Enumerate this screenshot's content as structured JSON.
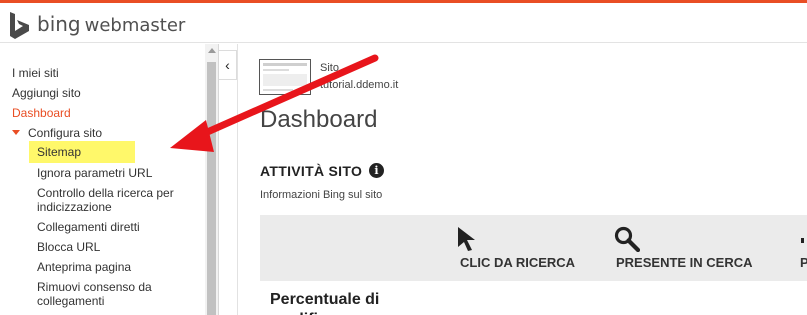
{
  "app": {
    "brand_bing": "bing",
    "brand_webmaster": "webmaster",
    "accent_color": "#e94e24"
  },
  "sidebar": {
    "items": [
      {
        "label": "I miei siti"
      },
      {
        "label": "Aggiungi sito"
      },
      {
        "label": "Dashboard",
        "active": true
      },
      {
        "label": "Configura sito",
        "expanded": true
      }
    ],
    "subitems": [
      {
        "label": "Sitemap",
        "highlighted": true
      },
      {
        "label": "Ignora parametri URL"
      },
      {
        "label": "Controllo della ricerca per indicizzazione"
      },
      {
        "label": "Collegamenti diretti"
      },
      {
        "label": "Blocca URL"
      },
      {
        "label": "Anteprima pagina"
      },
      {
        "label": "Rimuovi consenso da collegamenti"
      }
    ],
    "collapse_icon": "chevron-left-icon",
    "collapse_glyph": "‹"
  },
  "main": {
    "site_label": "Sito",
    "site_url": "tutorial.ddemo.it",
    "page_title": "Dashboard",
    "section_title": "ATTIVITÀ SITO",
    "info_glyph": "i",
    "section_subtitle": "Informazioni Bing sul sito",
    "columns": [
      {
        "label": "CLIC DA RICERCA",
        "icon": "cursor-icon"
      },
      {
        "label": "PRESENTE IN CERCA",
        "icon": "search-icon"
      }
    ],
    "cut_column_label": "P",
    "row_label_line1": "Percentuale di",
    "row_label_line2": "modifica"
  },
  "annotation": {
    "highlight_color": "#fff86a",
    "arrow_color": "#e8151b"
  }
}
